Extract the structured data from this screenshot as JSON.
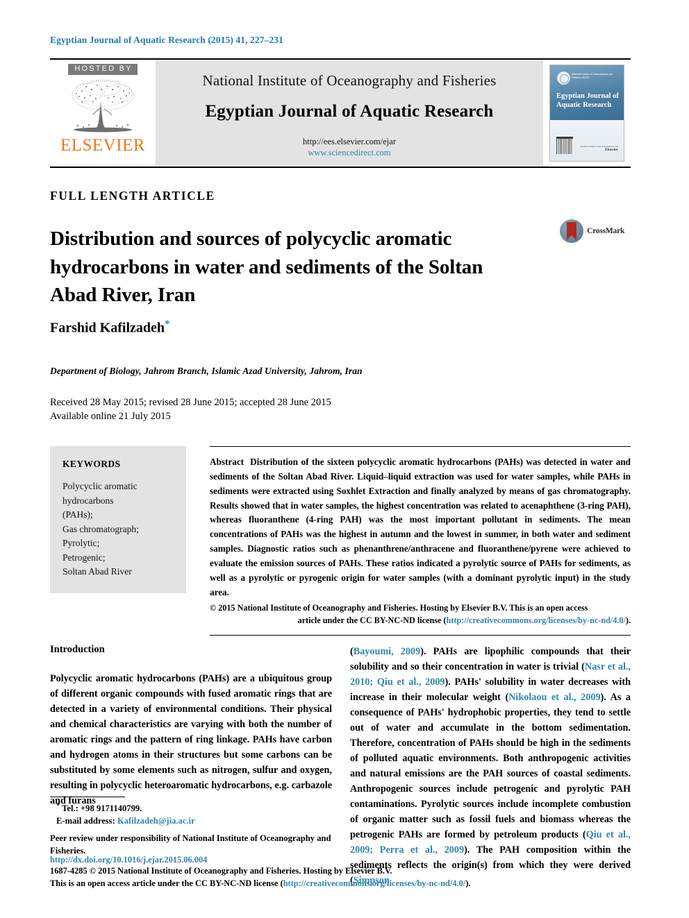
{
  "running_head": "Egyptian Journal of Aquatic Research (2015) 41, 227–231",
  "masthead": {
    "hosted_by": "HOSTED BY",
    "publisher": "ELSEVIER",
    "institute": "National Institute of Oceanography and Fisheries",
    "journal_title": "Egyptian Journal of Aquatic Research",
    "url_editorial": "http://ees.elsevier.com/ejar",
    "url_sciencedirect": "www.sciencedirect.com",
    "cover": {
      "org_line": "National Institute of Oceanography and Fisheries (NIOF)",
      "title": "Egyptian Journal of Aquatic Research",
      "publisher": "Elsevier",
      "publisher_sub": "Available online at www.sciencedirect.com"
    }
  },
  "article": {
    "type": "FULL LENGTH ARTICLE",
    "title": "Distribution and sources of polycyclic aromatic hydrocarbons in water and sediments of the Soltan Abad River, Iran",
    "crossmark_label": "CrossMark",
    "author": "Farshid Kafilzadeh",
    "author_marker": "*",
    "affiliation": "Department of Biology, Jahrom Branch, Islamic Azad University, Jahrom, Iran",
    "history_received": "Received 28 May 2015; revised 28 June 2015; accepted 28 June 2015",
    "history_online": "Available online 21 July 2015"
  },
  "keywords": {
    "heading": "KEYWORDS",
    "items": [
      "Polycyclic aromatic",
      "hydrocarbons",
      "(PAHs);",
      "Gas chromatograph;",
      "Pyrolytic;",
      "Petrogenic;",
      "Soltan Abad River"
    ]
  },
  "abstract": {
    "label": "Abstract",
    "text": "Distribution of the sixteen polycyclic aromatic hydrocarbons (PAHs) was detected in water and sediments of the Soltan Abad River. Liquid–liquid extraction was used for water samples, while PAHs in sediments were extracted using Soxhlet Extraction and finally analyzed by means of gas chromatography. Results showed that in water samples, the highest concentration was related to acenaphthene (3-ring PAH), whereas fluoranthene (4-ring PAH) was the most important pollutant in sediments. The mean concentrations of PAHs was the highest in autumn and the lowest in summer, in both water and sediment samples. Diagnostic ratios such as phenanthrene/anthracene and fluoranthene/pyrene were achieved to evaluate the emission sources of PAHs. These ratios indicated a pyrolytic source of PAHs for sediments, as well as a pyrolytic or pyrogenic origin for water samples (with a dominant pyrolytic input) in the study area.",
    "copyright_line1": "© 2015 National Institute of Oceanography and Fisheries. Hosting by Elsevier B.V. This is an open access",
    "copyright_line2_pre": "article under the CC BY-NC-ND license (",
    "copyright_link": "http://creativecommons.org/licenses/by-nc-nd/4.0/",
    "copyright_line2_post": ")."
  },
  "introduction": {
    "heading": "Introduction",
    "left_paragraph": "Polycyclic aromatic hydrocarbons (PAHs) are a ubiquitous group of different organic compounds with fused aromatic rings that are detected in a variety of environmental conditions. Their physical and chemical characteristics are varying with both the number of aromatic rings and the pattern of ring linkage. PAHs have carbon and hydrogen atoms in their structures but some carbons can be substituted by some elements such as nitrogen, sulfur and oxygen, resulting in polycyclic heteroaromatic hydrocarbons, e.g. carbazole and furans",
    "right_segments": [
      {
        "text": "(",
        "link": false
      },
      {
        "text": "Bayoumi, 2009",
        "link": true
      },
      {
        "text": "). PAHs are lipophilic compounds that their solubility and so their concentration in water is trivial (",
        "link": false
      },
      {
        "text": "Nasr et al., 2010; Qiu et al., 2009",
        "link": true
      },
      {
        "text": "). PAHs' solubility in water decreases with increase in their molecular weight (",
        "link": false
      },
      {
        "text": "Nikolaou et al., 2009",
        "link": true
      },
      {
        "text": "). As a consequence of PAHs' hydrophobic properties, they tend to settle out of water and accumulate in the bottom sedimentation. Therefore, concentration of PAHs should be high in the sediments of polluted aquatic environments. Both anthropogenic activities and natural emissions are the PAH sources of coastal sediments. Anthropogenic sources include petrogenic and pyrolytic PAH contaminations. Pyrolytic sources include incomplete combustion of organic matter such as fossil fuels and biomass whereas the petrogenic PAHs are formed by petroleum products (",
        "link": false
      },
      {
        "text": "Qiu et al., 2009; Perra et al., 2009",
        "link": true
      },
      {
        "text": "). The PAH composition within the sediments reflects the origin(s) from which they were derived (",
        "link": false
      },
      {
        "text": "Simpson",
        "link": true
      }
    ]
  },
  "footnote": {
    "tel_marker": "*",
    "tel": "Tel.: +98 9171140799.",
    "email_label": "E-mail address:",
    "email": "Kafilzadeh@jia.ac.ir",
    "peer_review": "Peer review under responsibility of National Institute of Oceanography and Fisheries."
  },
  "page_footer": {
    "doi": "http://dx.doi.org/10.1016/j.ejar.2015.06.004",
    "issn_line": "1687-4285 © 2015 National Institute of Oceanography and Fisheries. Hosting by Elsevier B.V.",
    "license_pre": "This is an open access article under the CC BY-NC-ND license (",
    "license_link": "http://creativecommons.org/licenses/by-nc-nd/4.0/",
    "license_post": ")."
  },
  "colors": {
    "link": "#2e86ab",
    "running_head": "#1a7fa8",
    "elsevier_orange": "#F3761B",
    "panel_gray": "#e3e3e3",
    "crossmark_red": "#b0281a"
  }
}
